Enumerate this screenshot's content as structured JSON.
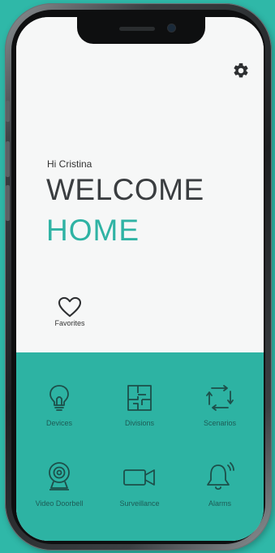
{
  "header": {
    "settings_icon": "gear-icon"
  },
  "greeting": {
    "hi": "Hi Cristina",
    "welcome": "WELCOME",
    "home": "HOME"
  },
  "favorites": {
    "icon": "heart-icon",
    "label": "Favorites"
  },
  "menu": [
    {
      "label": "Devices",
      "icon": "lightbulb-icon"
    },
    {
      "label": "Divisions",
      "icon": "floorplan-icon"
    },
    {
      "label": "Scenarios",
      "icon": "scenarios-icon"
    },
    {
      "label": "Video Doorbell",
      "icon": "doorbell-camera-icon"
    },
    {
      "label": "Surveillance",
      "icon": "video-camera-icon"
    },
    {
      "label": "Alarms",
      "icon": "bell-icon"
    }
  ],
  "colors": {
    "accent": "#2fb3a4",
    "panel": "#2db3a3",
    "background": "#f6f7f7",
    "text": "#3a3d40",
    "icon_stroke": "#1d4f4a"
  }
}
